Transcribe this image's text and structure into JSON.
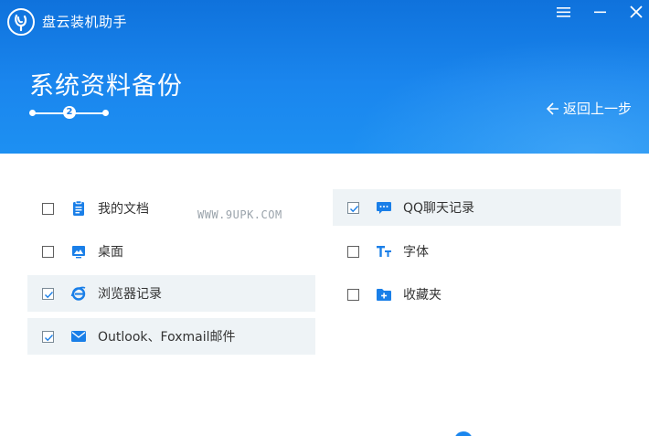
{
  "app": {
    "title": "盘云装机助手"
  },
  "page": {
    "title": "系统资料备份",
    "step": "2",
    "back_label": "返回上一步"
  },
  "watermark": "WWW.9UPK.COM",
  "left_items": [
    {
      "label": "我的文档",
      "checked": false,
      "icon": "document-icon"
    },
    {
      "label": "桌面",
      "checked": false,
      "icon": "desktop-icon"
    },
    {
      "label": "浏览器记录",
      "checked": true,
      "icon": "ie-browser-icon"
    },
    {
      "label": "Outlook、Foxmail邮件",
      "checked": true,
      "icon": "mail-icon"
    }
  ],
  "right_items": [
    {
      "label": "QQ聊天记录",
      "checked": true,
      "icon": "chat-icon"
    },
    {
      "label": "字体",
      "checked": false,
      "icon": "font-icon"
    },
    {
      "label": "收藏夹",
      "checked": false,
      "icon": "favorites-folder-icon"
    }
  ],
  "colors": {
    "header_blue": "#1a86ee",
    "icon_blue": "#1a7fe8",
    "checked_row_bg": "#eef3f6"
  }
}
